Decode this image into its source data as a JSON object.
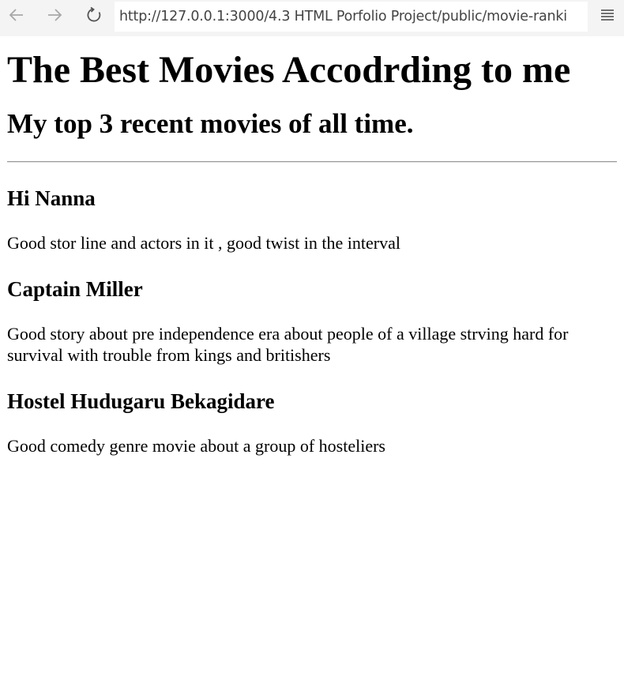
{
  "browser": {
    "url": "http://127.0.0.1:3000/4.3 HTML Porfolio Project/public/movie-ranki",
    "back_icon": "arrow-left-icon",
    "forward_icon": "arrow-right-icon",
    "reload_icon": "reload-icon",
    "menu_icon": "hamburger-menu-icon"
  },
  "page": {
    "title": "The Best Movies Accodrding to me",
    "subtitle": "My top 3 recent movies of all time.",
    "movies": [
      {
        "name": "Hi Nanna",
        "review": "Good stor line and actors in it , good twist in the interval"
      },
      {
        "name": "Captain Miller",
        "review": "Good story about pre independence era about people of a village strving hard for survival with trouble from kings and britishers"
      },
      {
        "name": "Hostel Hudugaru Bekagidare",
        "review": "Good comedy genre movie about a group of hosteliers"
      }
    ]
  }
}
